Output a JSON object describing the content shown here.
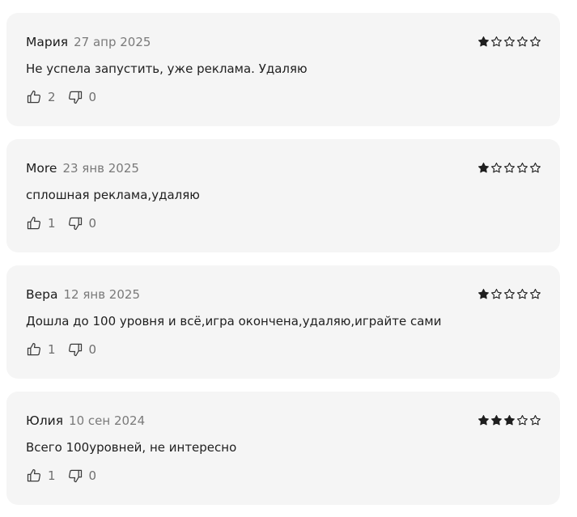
{
  "reviews": [
    {
      "author": "Мария",
      "date": "27 апр 2025",
      "rating": 1,
      "text": "Не успела запустить, уже реклама. Удаляю",
      "likes": "2",
      "dislikes": "0"
    },
    {
      "author": "More",
      "date": "23 янв 2025",
      "rating": 1,
      "text": "сплошная реклама,удаляю",
      "likes": "1",
      "dislikes": "0"
    },
    {
      "author": "Вера",
      "date": "12 янв 2025",
      "rating": 1,
      "text": "Дошла до 100 уровня и всё,игра окончена,удаляю,играйте сами",
      "likes": "1",
      "dislikes": "0"
    },
    {
      "author": "Юлия",
      "date": "10 сен 2024",
      "rating": 3,
      "text": "Всего 100уровней, не интересно",
      "likes": "1",
      "dislikes": "0"
    }
  ],
  "rating_max": 5,
  "icons": {
    "star_filled": "star-filled-icon",
    "star_empty": "star-empty-icon",
    "like": "thumbs-up-icon",
    "dislike": "thumbs-down-icon"
  },
  "colors": {
    "card_bg": "#f5f5f5",
    "star": "#1f1f1f",
    "meta": "#7a7a7a"
  }
}
